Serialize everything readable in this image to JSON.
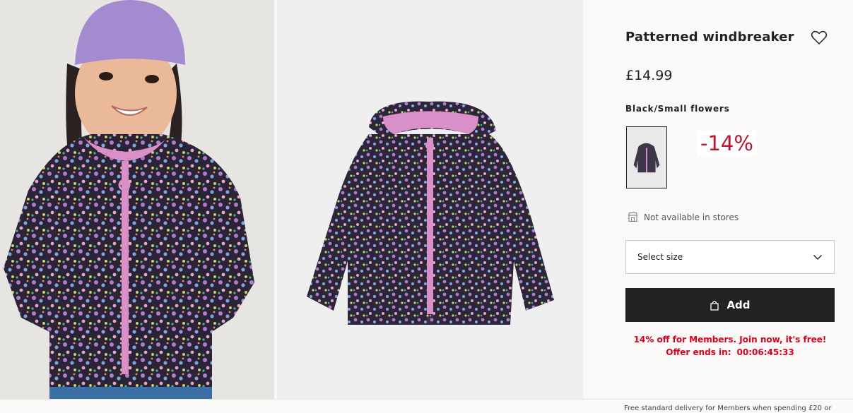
{
  "product": {
    "title": "Patterned windbreaker",
    "price": "£14.99",
    "color_name": "Black/Small flowers",
    "discount_badge": "-14%",
    "availability": "Not available in stores",
    "size_select_label": "Select size",
    "add_button_label": "Add",
    "promo_line1": "14% off for Members. Join now, it's free!",
    "promo_offer_label": "Offer ends in:",
    "promo_timer": "00:06:45:33",
    "delivery_note": "Free standard delivery for Members when spending £20 or"
  },
  "colors": {
    "accent_red": "#c8102e",
    "promo_red": "#e0001b",
    "button_dark": "#222222",
    "jacket_zip_pink": "#d98fc8"
  },
  "icons": {
    "favorite": "heart-icon",
    "store": "store-icon",
    "dropdown": "chevron-down-icon",
    "bag": "shopping-bag-icon"
  }
}
